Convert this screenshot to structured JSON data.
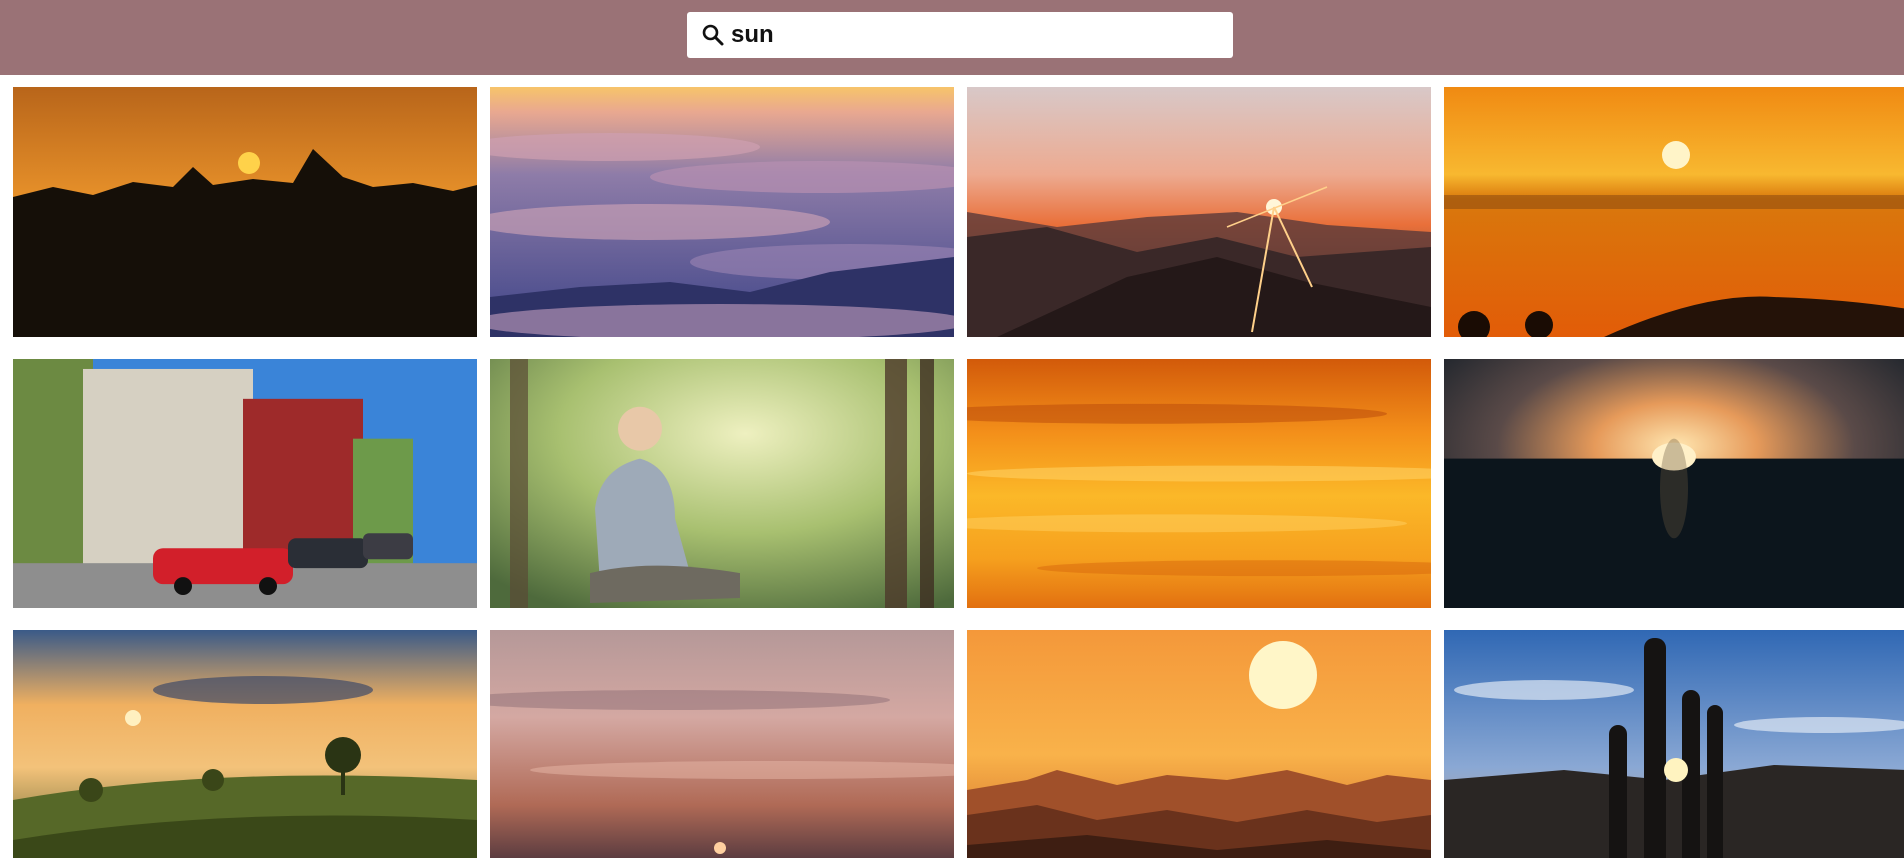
{
  "search": {
    "query": "sun",
    "icon": "search-icon"
  },
  "results": [
    {
      "id": "sunset-forest-silhouette",
      "colors": [
        "#e7912a",
        "#1a1208"
      ]
    },
    {
      "id": "sea-of-clouds",
      "colors": [
        "#f0c27a",
        "#4a4c86"
      ]
    },
    {
      "id": "mountain-sunburst",
      "colors": [
        "#e9b6a0",
        "#2a1f1f"
      ]
    },
    {
      "id": "orange-ocean-sun",
      "colors": [
        "#f4a21f",
        "#e56a0b"
      ]
    },
    {
      "id": "street-red-car",
      "colors": [
        "#3a80d4",
        "#c9202a"
      ]
    },
    {
      "id": "boy-meditating-forest",
      "colors": [
        "#c8d68a",
        "#5e7d5c"
      ]
    },
    {
      "id": "orange-sky-streaks",
      "colors": [
        "#f5a21c",
        "#c9540a"
      ]
    },
    {
      "id": "dark-desert-sunrise",
      "colors": [
        "#ffdca0",
        "#0c1620"
      ]
    },
    {
      "id": "foggy-meadow-sunrise",
      "colors": [
        "#f0b060",
        "#3a4a20"
      ]
    },
    {
      "id": "pastel-cloud-sunset",
      "colors": [
        "#c8a6a8",
        "#7a4a4a"
      ]
    },
    {
      "id": "mountains-bright-sun",
      "colors": [
        "#f7a73a",
        "#5a2a1a"
      ]
    },
    {
      "id": "cactus-sunburst",
      "colors": [
        "#3b6eb8",
        "#1b1a1a"
      ]
    }
  ]
}
